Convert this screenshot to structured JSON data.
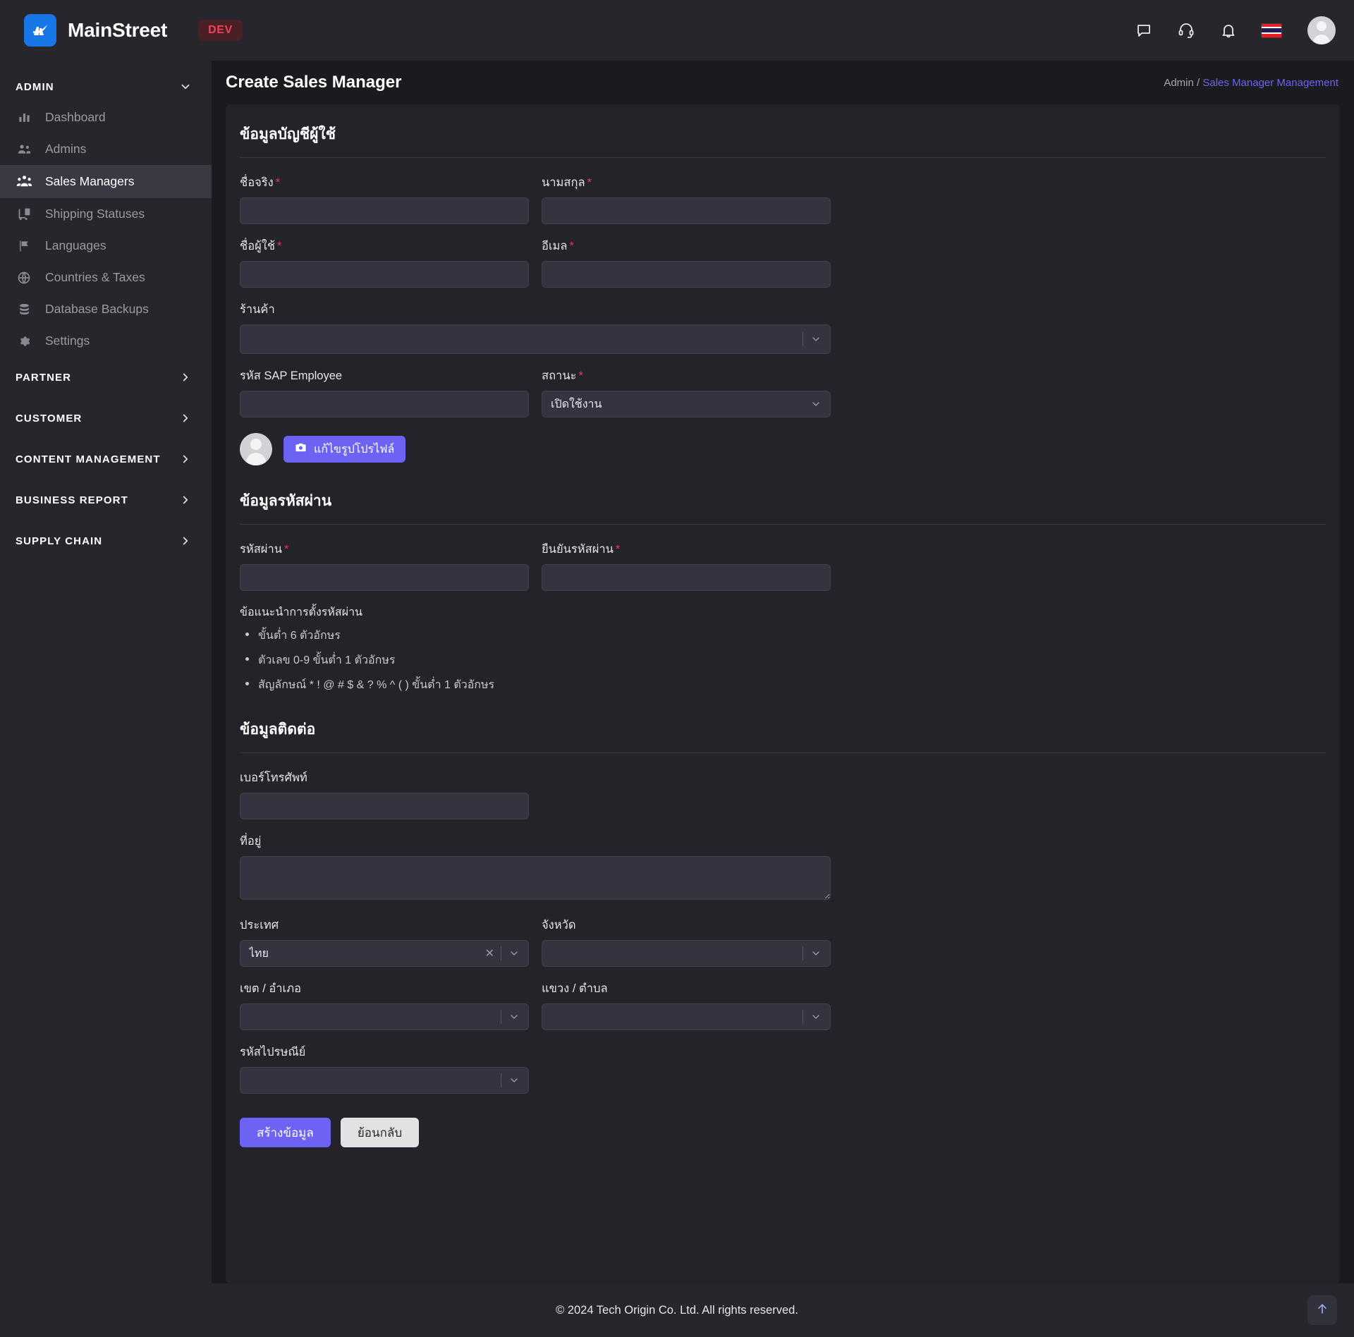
{
  "topbar": {
    "brand_name": "MainStreet",
    "env_badge": "DEV",
    "icons": [
      "chat-icon",
      "headset-icon",
      "bell-icon",
      "thai-flag-icon",
      "user-avatar"
    ]
  },
  "sidebar": {
    "admin_group": {
      "label": "ADMIN",
      "items": [
        {
          "label": "Dashboard",
          "icon": "bar-chart-icon",
          "active": false
        },
        {
          "label": "Admins",
          "icon": "users-icon",
          "active": false
        },
        {
          "label": "Sales Managers",
          "icon": "people-group-icon",
          "active": true
        },
        {
          "label": "Shipping Statuses",
          "icon": "truck-loading-icon",
          "active": false
        },
        {
          "label": "Languages",
          "icon": "flag-icon",
          "active": false
        },
        {
          "label": "Countries & Taxes",
          "icon": "globe-icon",
          "active": false
        },
        {
          "label": "Database Backups",
          "icon": "database-icon",
          "active": false
        },
        {
          "label": "Settings",
          "icon": "gear-icon",
          "active": false
        }
      ]
    },
    "groups": [
      {
        "label": "PARTNER"
      },
      {
        "label": "CUSTOMER"
      },
      {
        "label": "CONTENT MANAGEMENT"
      },
      {
        "label": "BUSINESS REPORT"
      },
      {
        "label": "SUPPLY CHAIN"
      }
    ]
  },
  "page": {
    "title": "Create Sales Manager",
    "breadcrumb_root": "Admin",
    "breadcrumb_sep": "/",
    "breadcrumb_current": "Sales Manager Management"
  },
  "form": {
    "account_section": {
      "title": "ข้อมูลบัญชีผู้ใช้",
      "first_name_label": "ชื่อจริง",
      "first_name_value": "",
      "last_name_label": "นามสกุล",
      "last_name_value": "",
      "username_label": "ชื่อผู้ใช้",
      "username_value": "",
      "email_label": "อีเมล",
      "email_value": "",
      "store_label": "ร้านค้า",
      "store_value": "",
      "sap_label": "รหัส SAP Employee",
      "sap_value": "",
      "status_label": "สถานะ",
      "status_value": "เปิดใช้งาน",
      "upload_button": "แก้ไขรูปโปรไฟล์"
    },
    "password_section": {
      "title": "ข้อมูลรหัสผ่าน",
      "password_label": "รหัสผ่าน",
      "password_value": "",
      "confirm_label": "ยืนยันรหัสผ่าน",
      "confirm_value": "",
      "hint_title": "ข้อแนะนำการตั้งรหัสผ่าน",
      "hints": [
        "ขั้นต่ำ 6 ตัวอักษร",
        "ตัวเลข 0-9 ขั้นต่ำ 1 ตัวอักษร",
        "สัญลักษณ์ * ! @ # $ & ? % ^ ( ) ขั้นต่ำ 1 ตัวอักษร"
      ]
    },
    "contact_section": {
      "title": "ข้อมูลติดต่อ",
      "phone_label": "เบอร์โทรศัพท์",
      "phone_value": "",
      "address_label": "ที่อยู่",
      "address_value": "",
      "country_label": "ประเทศ",
      "country_value": "ไทย",
      "province_label": "จังหวัด",
      "province_value": "",
      "district_label": "เขต / อำเภอ",
      "district_value": "",
      "subdistrict_label": "แขวง / ตำบล",
      "subdistrict_value": "",
      "postcode_label": "รหัสไปรษณีย์",
      "postcode_value": ""
    },
    "actions": {
      "submit_label": "สร้างข้อมูล",
      "back_label": "ย้อนกลับ"
    }
  },
  "footer": {
    "copyright": "© 2024 Tech Origin Co. Ltd. All rights reserved.",
    "to_top_icon": "arrow-up-icon"
  },
  "colors": {
    "accent": "#6c63f5",
    "brand_blue": "#1877e6",
    "danger": "#e03a52",
    "panel": "#232329",
    "chrome": "#26262c",
    "input": "#343440"
  }
}
